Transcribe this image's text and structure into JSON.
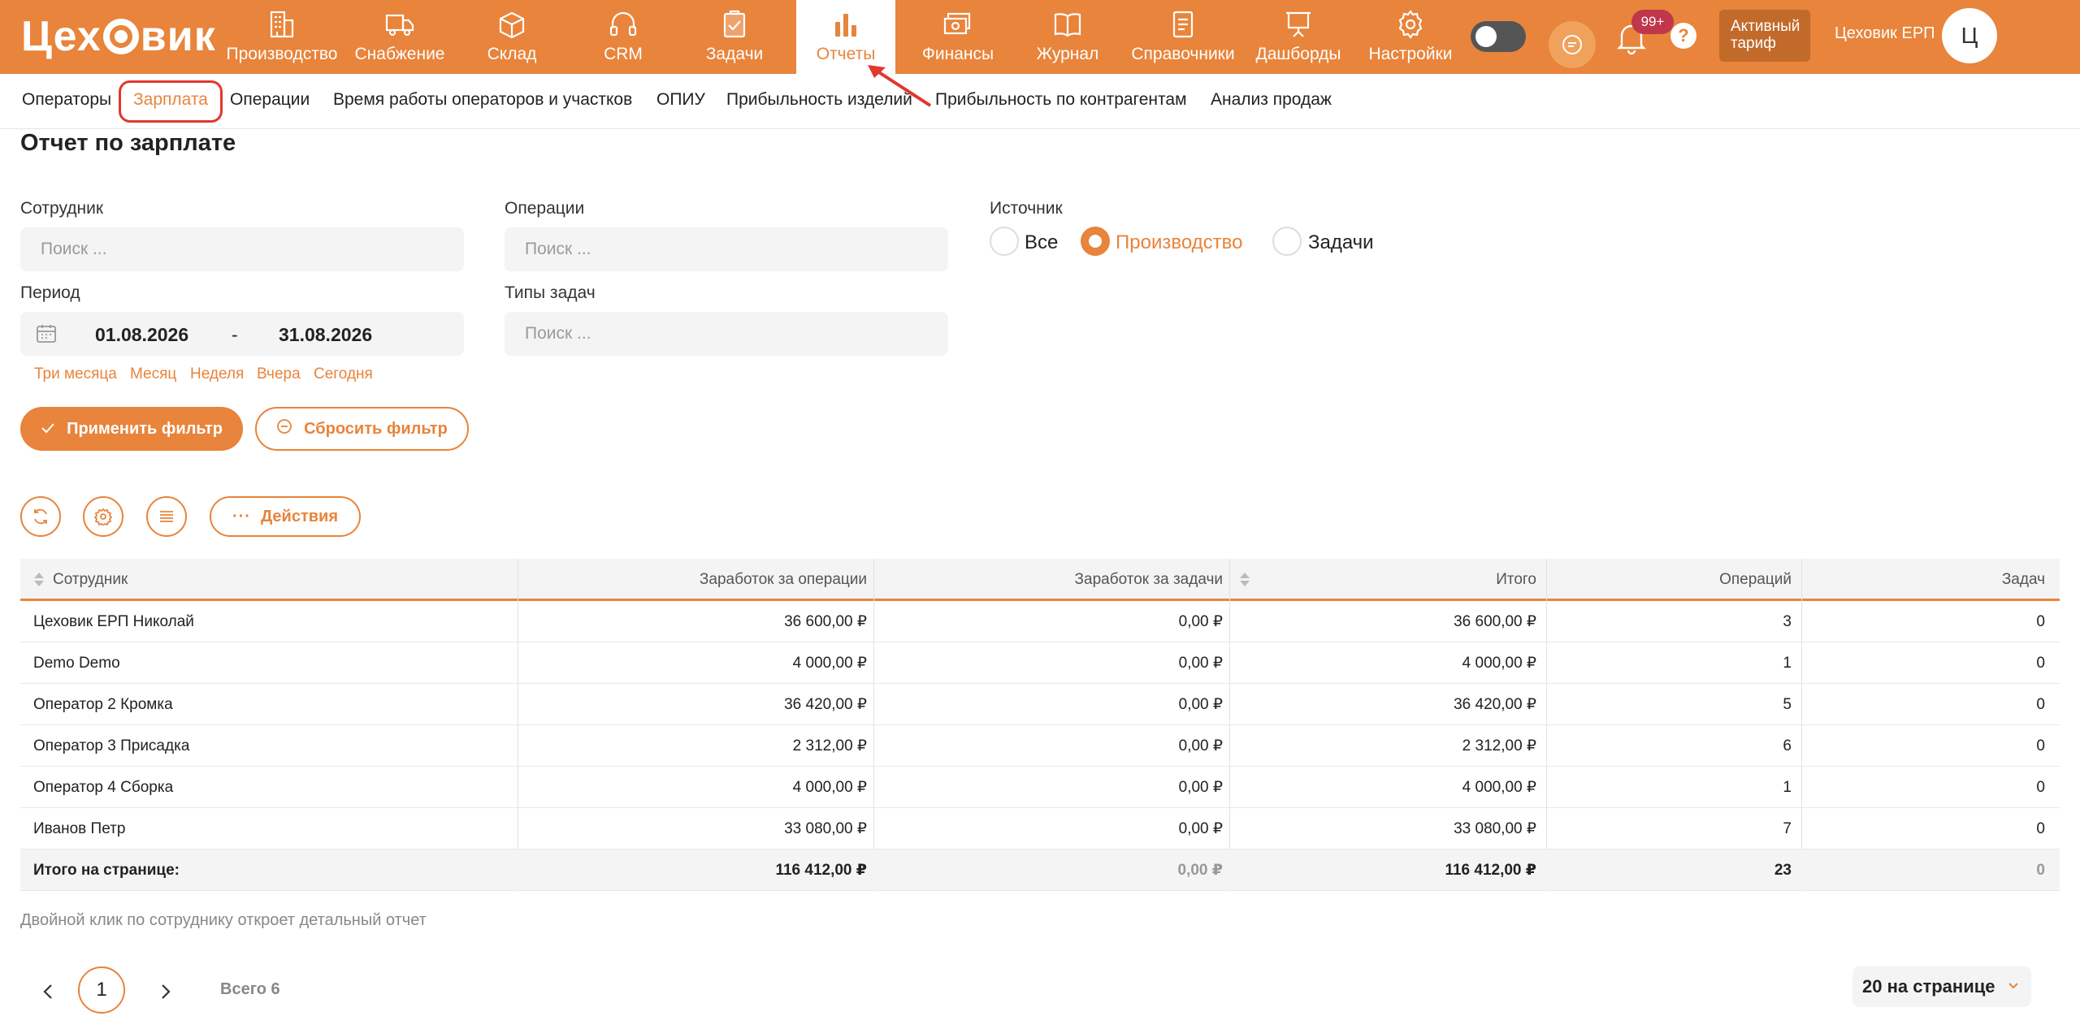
{
  "app": {
    "logo_text": "Цеховик"
  },
  "nav": [
    {
      "label": "Производство",
      "icon": "building-icon"
    },
    {
      "label": "Снабжение",
      "icon": "truck-icon"
    },
    {
      "label": "Склад",
      "icon": "box-icon"
    },
    {
      "label": "CRM",
      "icon": "headset-icon"
    },
    {
      "label": "Задачи",
      "icon": "clipboard-check-icon"
    },
    {
      "label": "Отчеты",
      "icon": "bar-chart-icon",
      "active": true
    },
    {
      "label": "Финансы",
      "icon": "money-icon"
    },
    {
      "label": "Журнал",
      "icon": "book-icon"
    },
    {
      "label": "Справочники",
      "icon": "document-icon"
    },
    {
      "label": "Дашборды",
      "icon": "presentation-icon"
    },
    {
      "label": "Настройки",
      "icon": "gear-icon"
    }
  ],
  "header": {
    "notifications_badge": "99+",
    "help": "?",
    "tariff": "Активный тариф",
    "company": "Цеховик ЕРП",
    "avatar_letter": "Ц"
  },
  "subtabs": [
    "Операторы",
    "Зарплата",
    "Операции",
    "Время работы операторов и участков",
    "ОПИУ",
    "Прибыльность изделий",
    "Прибыльность по контрагентам",
    "Анализ продаж"
  ],
  "active_subtab": "Зарплата",
  "page_title": "Отчет по зарплате",
  "filters": {
    "employee_label": "Сотрудник",
    "employee_placeholder": "Поиск ...",
    "operations_label": "Операции",
    "operations_placeholder": "Поиск ...",
    "task_types_label": "Типы задач",
    "task_types_placeholder": "Поиск ...",
    "period_label": "Период",
    "date_from": "01.08.2026",
    "date_sep": "-",
    "date_to": "31.08.2026",
    "quick_periods": [
      "Три месяца",
      "Месяц",
      "Неделя",
      "Вчера",
      "Сегодня"
    ],
    "source_label": "Источник",
    "source_options": [
      "Все",
      "Производство",
      "Задачи"
    ],
    "source_selected": "Производство",
    "apply_label": "Применить фильтр",
    "reset_label": "Сбросить фильтр"
  },
  "toolbar": {
    "actions_label": "Действия"
  },
  "table": {
    "columns": [
      "Сотрудник",
      "Заработок за операции",
      "Заработок за задачи",
      "Итого",
      "Операций",
      "Задач"
    ],
    "rows": [
      [
        "Цеховик ЕРП Николай",
        "36 600,00 ₽",
        "0,00 ₽",
        "36 600,00 ₽",
        "3",
        "0"
      ],
      [
        "Demo Demo",
        "4 000,00 ₽",
        "0,00 ₽",
        "4 000,00 ₽",
        "1",
        "0"
      ],
      [
        "Оператор 2 Кромка",
        "36 420,00 ₽",
        "0,00 ₽",
        "36 420,00 ₽",
        "5",
        "0"
      ],
      [
        "Оператор 3 Присадка",
        "2 312,00 ₽",
        "0,00 ₽",
        "2 312,00 ₽",
        "6",
        "0"
      ],
      [
        "Оператор 4 Сборка",
        "4 000,00 ₽",
        "0,00 ₽",
        "4 000,00 ₽",
        "1",
        "0"
      ],
      [
        "Иванов Петр",
        "33 080,00 ₽",
        "0,00 ₽",
        "33 080,00 ₽",
        "7",
        "0"
      ]
    ],
    "total": [
      "Итого на странице:",
      "116 412,00 ₽",
      "0,00 ₽",
      "116 412,00 ₽",
      "23",
      "0"
    ]
  },
  "hint": "Двойной клик по сотруднику откроет детальный отчет",
  "pagination": {
    "current_page": "1",
    "total": "Всего 6",
    "per_page": "20 на странице"
  },
  "colors": {
    "accent": "#E8843B",
    "highlight_ring": "#E0382C",
    "badge": "#C0364A"
  }
}
